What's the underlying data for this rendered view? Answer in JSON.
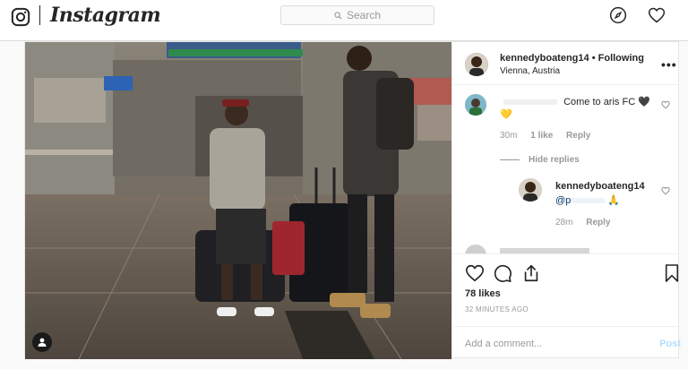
{
  "header": {
    "wordmark": "Instagram",
    "search_placeholder": "Search"
  },
  "post": {
    "username": "kennedyboateng14",
    "separator": "•",
    "follow_status": "Following",
    "location": "Vienna, Austria",
    "more_label": "•••",
    "comments": [
      {
        "username": "",
        "text": "Come to aris FC",
        "emoji": "🖤💛",
        "age": "30m",
        "likes": "1 like",
        "reply": "Reply",
        "replies_toggle": "Hide replies"
      },
      {
        "username": "kennedyboateng14",
        "text": "@p",
        "emoji": "🙏",
        "age": "28m",
        "reply": "Reply"
      }
    ],
    "likes": "78 likes",
    "posted": "32 MINUTES AGO",
    "comment_placeholder": "Add a comment...",
    "post_label": "Post"
  },
  "colors": {
    "accent": "#0095f6",
    "post_disabled": "#b2dffc",
    "border": "#dbdbdb"
  }
}
